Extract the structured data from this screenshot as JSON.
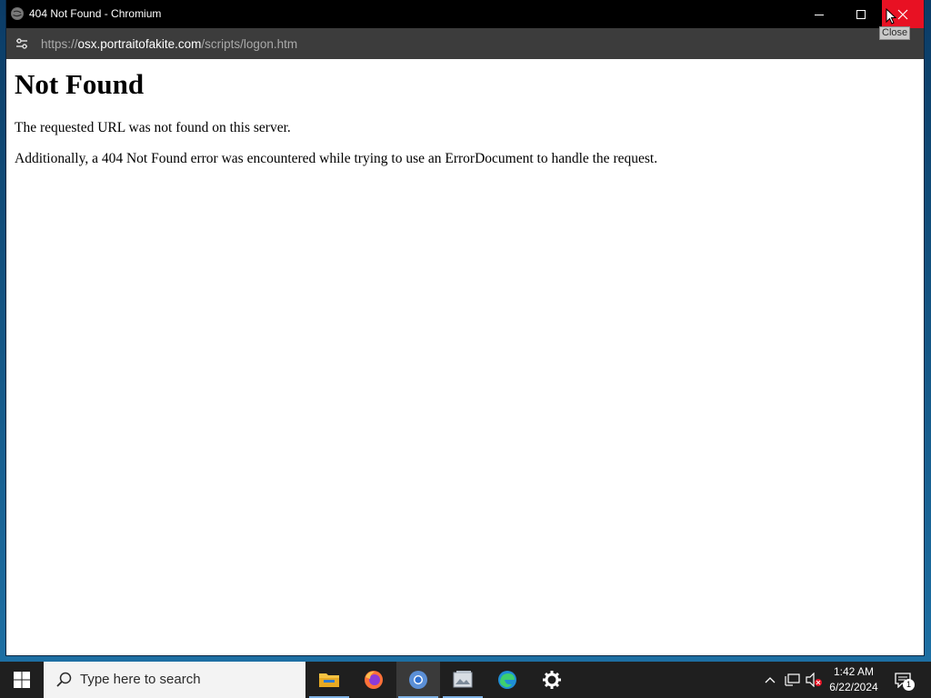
{
  "window": {
    "title": "404 Not Found - Chromium",
    "close_tooltip": "Close"
  },
  "addressbar": {
    "url_scheme": "https://",
    "url_host": "osx.portraitofakite.com",
    "url_path": "/scripts/logon.htm"
  },
  "page": {
    "heading": "Not Found",
    "paragraph1": "The requested URL was not found on this server.",
    "paragraph2": "Additionally, a 404 Not Found error was encountered while trying to use an ErrorDocument to handle the request."
  },
  "taskbar": {
    "search_placeholder": "Type here to search",
    "apps": [
      {
        "icon": "file-explorer-icon",
        "running": true
      },
      {
        "icon": "firefox-icon",
        "running": false
      },
      {
        "icon": "chromium-icon",
        "running": true,
        "active": true
      },
      {
        "icon": "image-viewer-icon",
        "running": true
      },
      {
        "icon": "edge-icon",
        "running": false
      },
      {
        "icon": "settings-gear-icon",
        "running": false
      }
    ],
    "clock_time": "1:42 AM",
    "clock_date": "6/22/2024",
    "notification_count": "1"
  },
  "colors": {
    "close_button": "#e81123",
    "titlebar": "#000000",
    "addressbar": "#3c3c3c",
    "taskbar": "#1f1f1f"
  }
}
